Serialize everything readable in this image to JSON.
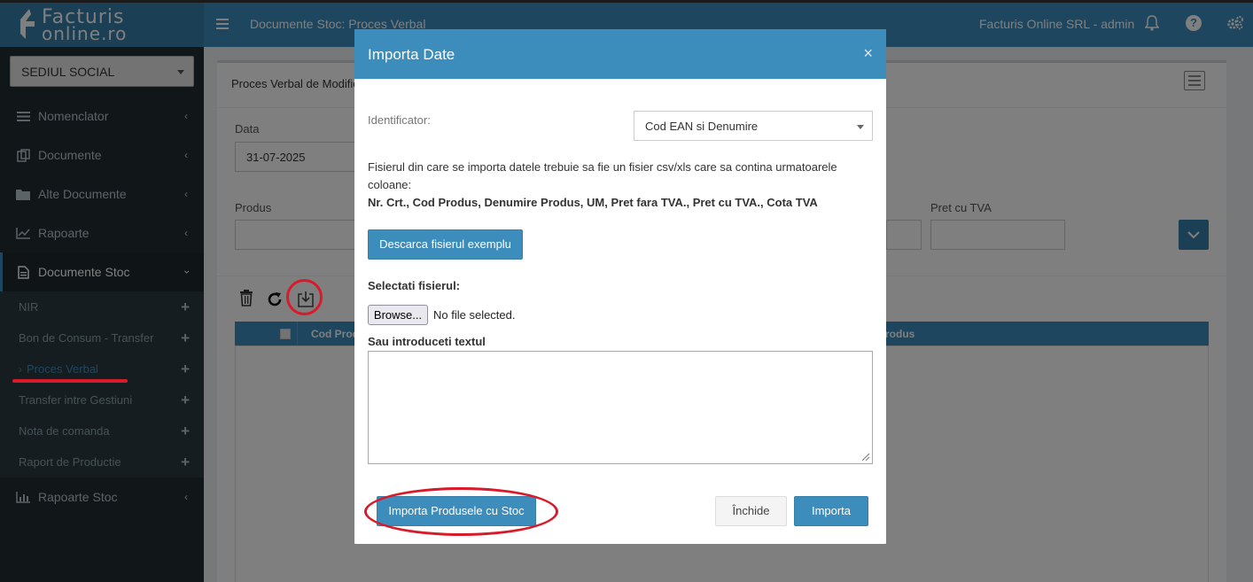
{
  "app": {
    "logo_line1": "Facturis",
    "logo_line2": "online.ro"
  },
  "sidebar": {
    "branch": "SEDIUL SOCIAL",
    "items": [
      {
        "label": "Nomenclator"
      },
      {
        "label": "Documente"
      },
      {
        "label": "Alte Documente"
      },
      {
        "label": "Rapoarte"
      },
      {
        "label": "Documente Stoc"
      }
    ],
    "submenu": [
      {
        "label": "NIR"
      },
      {
        "label": "Bon de Consum - Transfer"
      },
      {
        "label": "Proces Verbal"
      },
      {
        "label": "Transfer intre Gestiuni"
      },
      {
        "label": "Nota de comanda"
      },
      {
        "label": "Raport de Productie"
      }
    ],
    "last_item": {
      "label": "Rapoarte Stoc"
    }
  },
  "header": {
    "title": "Documente Stoc: Proces Verbal",
    "user": "Facturis Online SRL - admin",
    "help": "?"
  },
  "page": {
    "box_title": "Proces Verbal de Modific",
    "data_label": "Data",
    "data_value": "31-07-2025",
    "produs_label": "Produs",
    "pret_tva_label": "Pret cu TVA",
    "table_col_cod": "Cod Prod",
    "table_col_produs": "rodus"
  },
  "modal": {
    "title": "Importa Date",
    "close": "×",
    "identificator_label": "Identificator:",
    "identificator_value": "Cod EAN si Denumire",
    "info_text": "Fisierul din care se importa datele trebuie sa fie un fisier csv/xls care sa contina urmatoarele coloane:",
    "columns_text": "Nr. Crt., Cod Produs, Denumire Produs, UM, Pret fara TVA., Pret cu TVA., Cota TVA",
    "download_button": "Descarca fisierul exemplu",
    "select_file_label": "Selectati fisierul:",
    "browse_button": "Browse...",
    "no_file": "No file selected.",
    "text_label": "Sau introduceti textul",
    "textarea_value": "",
    "import_stock_button": "Importa Produsele cu Stoc",
    "close_button": "Închide",
    "import_button": "Importa"
  },
  "colors": {
    "primary": "#3c8dbc",
    "sidebar": "#222d32",
    "highlight": "#d91a2a"
  }
}
